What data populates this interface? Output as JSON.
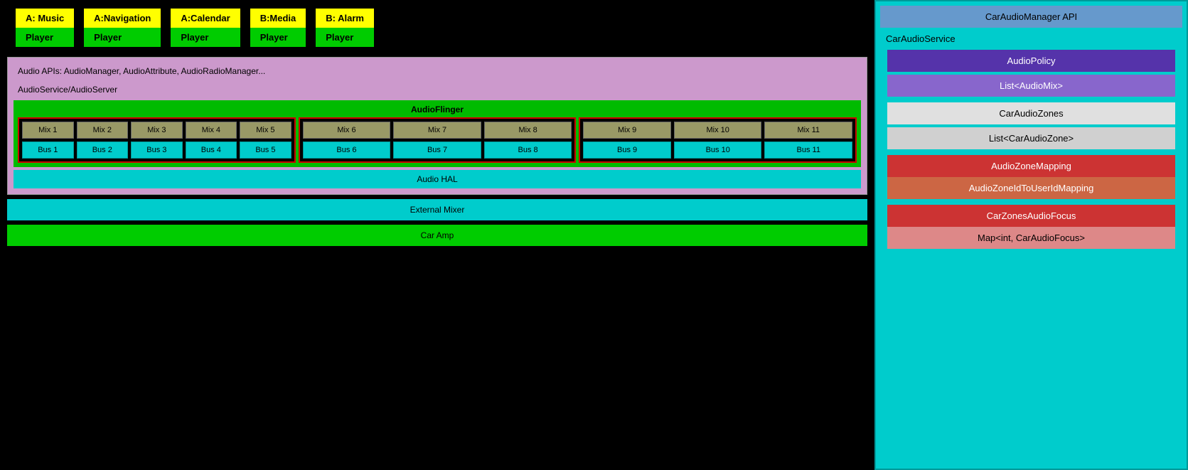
{
  "playerCards": [
    {
      "topLabel": "A: Music",
      "bottomLabel": "Player"
    },
    {
      "topLabel": "A:Navigation",
      "bottomLabel": "Player"
    },
    {
      "topLabel": "A:Calendar",
      "bottomLabel": "Player"
    },
    {
      "topLabel": "B:Media",
      "bottomLabel": "Player"
    },
    {
      "topLabel": "B: Alarm",
      "bottomLabel": "Player"
    }
  ],
  "apiLayerText": "Audio APIs: AudioManager, AudioAttribute, AudioRadioManager...",
  "audioServiceText": "AudioService/AudioServer",
  "audioFlingerText": "AudioFlinger",
  "zones": [
    {
      "mixes": [
        "Mix 1",
        "Mix 2",
        "Mix 3",
        "Mix 4",
        "Mix 5"
      ],
      "buses": [
        "Bus 1",
        "Bus 2",
        "Bus 3",
        "Bus 4",
        "Bus 5"
      ]
    },
    {
      "mixes": [
        "Mix 6",
        "Mix 7",
        "Mix 8"
      ],
      "buses": [
        "Bus 6",
        "Bus 7",
        "Bus 8"
      ]
    },
    {
      "mixes": [
        "Mix 9",
        "Mix 10",
        "Mix 11"
      ],
      "buses": [
        "Bus 9",
        "Bus 10",
        "Bus 11"
      ]
    }
  ],
  "audioHalText": "Audio HAL",
  "externalMixerText": "External Mixer",
  "carAmpText": "Car Amp",
  "rightPanel": {
    "carAudioManagerAPI": "CarAudioManager API",
    "carAudioServiceLabel": "CarAudioService",
    "audioPolicy": "AudioPolicy",
    "listAudioMix": "List<AudioMix>",
    "carAudioZones": "CarAudioZones",
    "listCarAudioZone": "List<CarAudioZone>",
    "audioZoneMapping": "AudioZoneMapping",
    "audioZoneIdToUserIdMapping": "AudioZoneIdToUserIdMapping",
    "carZonesAudioFocus": "CarZonesAudioFocus",
    "mapCarAudioFocus": "Map<int, CarAudioFocus>"
  }
}
